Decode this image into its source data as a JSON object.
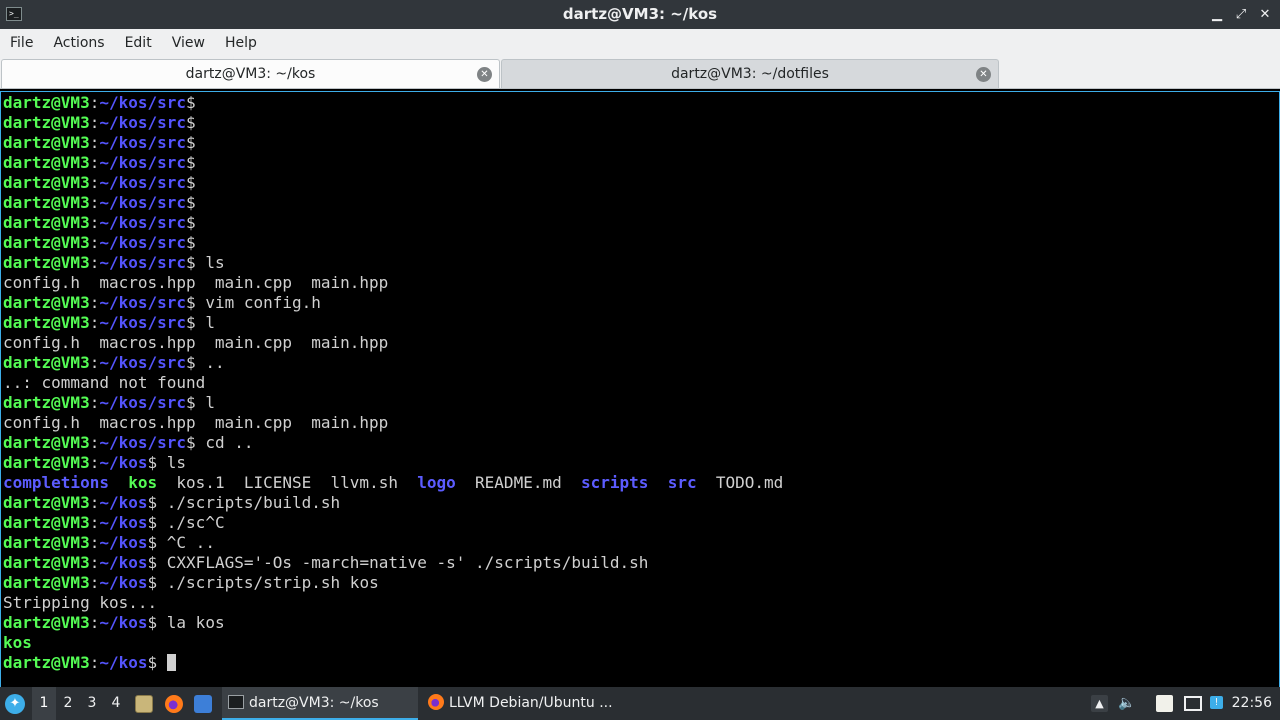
{
  "window": {
    "title": "dartz@VM3: ~/kos",
    "app_icon": ">_",
    "buttons": {
      "minimize": "▁",
      "maximize": "⤢",
      "close": "✕"
    }
  },
  "menu": [
    "File",
    "Actions",
    "Edit",
    "View",
    "Help"
  ],
  "tabs": [
    {
      "label": "dartz@VM3: ~/kos",
      "active": true
    },
    {
      "label": "dartz@VM3: ~/dotfiles",
      "active": false
    }
  ],
  "terminal": {
    "colors": {
      "user": "#54fc54",
      "path": "#5454fc",
      "dir": "#5c5cff",
      "exe": "#54fc54"
    },
    "lines": [
      [
        {
          "t": "dartz@VM3",
          "c": "ps-user"
        },
        {
          "t": ":",
          "c": "ps-plain"
        },
        {
          "t": "~/kos/src",
          "c": "ps-path"
        },
        {
          "t": "$",
          "c": "ps-plain"
        }
      ],
      [
        {
          "t": "dartz@VM3",
          "c": "ps-user"
        },
        {
          "t": ":",
          "c": "ps-plain"
        },
        {
          "t": "~/kos/src",
          "c": "ps-path"
        },
        {
          "t": "$",
          "c": "ps-plain"
        }
      ],
      [
        {
          "t": "dartz@VM3",
          "c": "ps-user"
        },
        {
          "t": ":",
          "c": "ps-plain"
        },
        {
          "t": "~/kos/src",
          "c": "ps-path"
        },
        {
          "t": "$",
          "c": "ps-plain"
        }
      ],
      [
        {
          "t": "dartz@VM3",
          "c": "ps-user"
        },
        {
          "t": ":",
          "c": "ps-plain"
        },
        {
          "t": "~/kos/src",
          "c": "ps-path"
        },
        {
          "t": "$",
          "c": "ps-plain"
        }
      ],
      [
        {
          "t": "dartz@VM3",
          "c": "ps-user"
        },
        {
          "t": ":",
          "c": "ps-plain"
        },
        {
          "t": "~/kos/src",
          "c": "ps-path"
        },
        {
          "t": "$",
          "c": "ps-plain"
        }
      ],
      [
        {
          "t": "dartz@VM3",
          "c": "ps-user"
        },
        {
          "t": ":",
          "c": "ps-plain"
        },
        {
          "t": "~/kos/src",
          "c": "ps-path"
        },
        {
          "t": "$",
          "c": "ps-plain"
        }
      ],
      [
        {
          "t": "dartz@VM3",
          "c": "ps-user"
        },
        {
          "t": ":",
          "c": "ps-plain"
        },
        {
          "t": "~/kos/src",
          "c": "ps-path"
        },
        {
          "t": "$",
          "c": "ps-plain"
        }
      ],
      [
        {
          "t": "dartz@VM3",
          "c": "ps-user"
        },
        {
          "t": ":",
          "c": "ps-plain"
        },
        {
          "t": "~/kos/src",
          "c": "ps-path"
        },
        {
          "t": "$",
          "c": "ps-plain"
        }
      ],
      [
        {
          "t": "dartz@VM3",
          "c": "ps-user"
        },
        {
          "t": ":",
          "c": "ps-plain"
        },
        {
          "t": "~/kos/src",
          "c": "ps-path"
        },
        {
          "t": "$ ls",
          "c": "ps-plain"
        }
      ],
      [
        {
          "t": "config.h  macros.hpp  main.cpp  main.hpp",
          "c": ""
        }
      ],
      [
        {
          "t": "dartz@VM3",
          "c": "ps-user"
        },
        {
          "t": ":",
          "c": "ps-plain"
        },
        {
          "t": "~/kos/src",
          "c": "ps-path"
        },
        {
          "t": "$ vim config.h",
          "c": "ps-plain"
        }
      ],
      [
        {
          "t": "dartz@VM3",
          "c": "ps-user"
        },
        {
          "t": ":",
          "c": "ps-plain"
        },
        {
          "t": "~/kos/src",
          "c": "ps-path"
        },
        {
          "t": "$ l",
          "c": "ps-plain"
        }
      ],
      [
        {
          "t": "config.h  macros.hpp  main.cpp  main.hpp",
          "c": ""
        }
      ],
      [
        {
          "t": "dartz@VM3",
          "c": "ps-user"
        },
        {
          "t": ":",
          "c": "ps-plain"
        },
        {
          "t": "~/kos/src",
          "c": "ps-path"
        },
        {
          "t": "$ ..",
          "c": "ps-plain"
        }
      ],
      [
        {
          "t": "..: command not found",
          "c": ""
        }
      ],
      [
        {
          "t": "dartz@VM3",
          "c": "ps-user"
        },
        {
          "t": ":",
          "c": "ps-plain"
        },
        {
          "t": "~/kos/src",
          "c": "ps-path"
        },
        {
          "t": "$ l",
          "c": "ps-plain"
        }
      ],
      [
        {
          "t": "config.h  macros.hpp  main.cpp  main.hpp",
          "c": ""
        }
      ],
      [
        {
          "t": "dartz@VM3",
          "c": "ps-user"
        },
        {
          "t": ":",
          "c": "ps-plain"
        },
        {
          "t": "~/kos/src",
          "c": "ps-path"
        },
        {
          "t": "$ cd ..",
          "c": "ps-plain"
        }
      ],
      [
        {
          "t": "dartz@VM3",
          "c": "ps-user"
        },
        {
          "t": ":",
          "c": "ps-plain"
        },
        {
          "t": "~/kos",
          "c": "ps-path"
        },
        {
          "t": "$ ls",
          "c": "ps-plain"
        }
      ],
      [
        {
          "t": "completions",
          "c": "dir"
        },
        {
          "t": "  ",
          "c": ""
        },
        {
          "t": "kos",
          "c": "exe"
        },
        {
          "t": "  kos.1  LICENSE  llvm.sh  ",
          "c": ""
        },
        {
          "t": "logo",
          "c": "dir"
        },
        {
          "t": "  README.md  ",
          "c": ""
        },
        {
          "t": "scripts",
          "c": "dir"
        },
        {
          "t": "  ",
          "c": ""
        },
        {
          "t": "src",
          "c": "dir"
        },
        {
          "t": "  TODO.md",
          "c": ""
        }
      ],
      [
        {
          "t": "dartz@VM3",
          "c": "ps-user"
        },
        {
          "t": ":",
          "c": "ps-plain"
        },
        {
          "t": "~/kos",
          "c": "ps-path"
        },
        {
          "t": "$ ./scripts/build.sh",
          "c": "ps-plain"
        }
      ],
      [
        {
          "t": "dartz@VM3",
          "c": "ps-user"
        },
        {
          "t": ":",
          "c": "ps-plain"
        },
        {
          "t": "~/kos",
          "c": "ps-path"
        },
        {
          "t": "$ ./sc^C",
          "c": "ps-plain"
        }
      ],
      [
        {
          "t": "dartz@VM3",
          "c": "ps-user"
        },
        {
          "t": ":",
          "c": "ps-plain"
        },
        {
          "t": "~/kos",
          "c": "ps-path"
        },
        {
          "t": "$ ^C ..",
          "c": "ps-plain"
        }
      ],
      [
        {
          "t": "dartz@VM3",
          "c": "ps-user"
        },
        {
          "t": ":",
          "c": "ps-plain"
        },
        {
          "t": "~/kos",
          "c": "ps-path"
        },
        {
          "t": "$ CXXFLAGS='-Os -march=native -s' ./scripts/build.sh",
          "c": "ps-plain"
        }
      ],
      [
        {
          "t": "dartz@VM3",
          "c": "ps-user"
        },
        {
          "t": ":",
          "c": "ps-plain"
        },
        {
          "t": "~/kos",
          "c": "ps-path"
        },
        {
          "t": "$ ./scripts/strip.sh kos",
          "c": "ps-plain"
        }
      ],
      [
        {
          "t": "Stripping kos...",
          "c": ""
        }
      ],
      [
        {
          "t": "dartz@VM3",
          "c": "ps-user"
        },
        {
          "t": ":",
          "c": "ps-plain"
        },
        {
          "t": "~/kos",
          "c": "ps-path"
        },
        {
          "t": "$ la kos",
          "c": "ps-plain"
        }
      ],
      [
        {
          "t": "kos",
          "c": "exe"
        }
      ],
      [
        {
          "t": "dartz@VM3",
          "c": "ps-user"
        },
        {
          "t": ":",
          "c": "ps-plain"
        },
        {
          "t": "~/kos",
          "c": "ps-path"
        },
        {
          "t": "$ ",
          "c": "ps-plain"
        },
        {
          "t": "",
          "c": "cursor"
        }
      ]
    ]
  },
  "taskbar": {
    "workspaces": [
      "1",
      "2",
      "3",
      "4"
    ],
    "active_workspace": "1",
    "tasks": [
      {
        "label": "dartz@VM3: ~/kos",
        "icon": "terminal-icon",
        "active": true
      },
      {
        "label": "LLVM Debian/Ubuntu ...",
        "icon": "firefox-icon",
        "active": false
      }
    ],
    "clock": "22:56"
  }
}
